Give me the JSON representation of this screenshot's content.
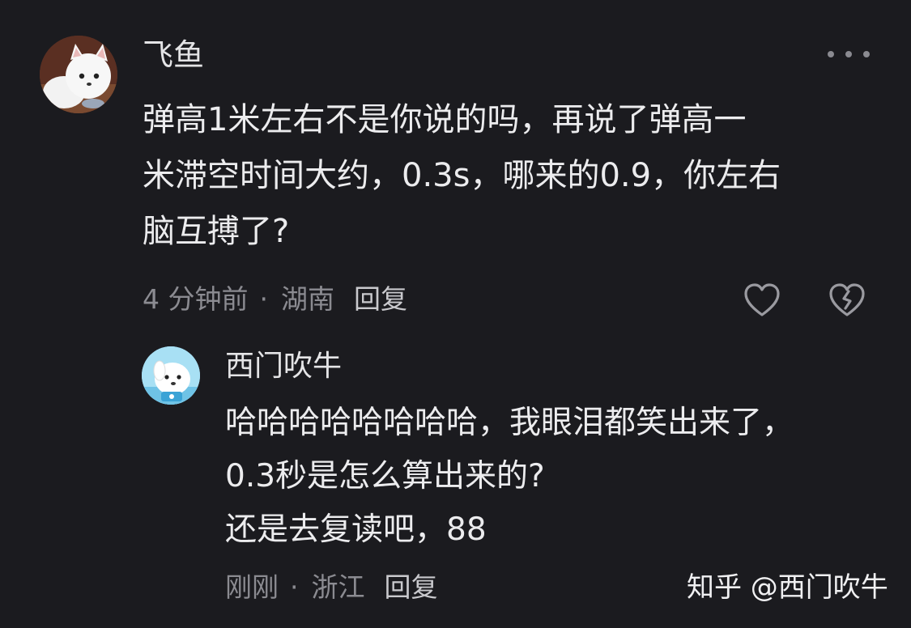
{
  "comment": {
    "author": "飞鱼",
    "text_lines": [
      "弹高1米左右不是你说的吗，再说了弹高一",
      "米滞空时间大约，0.3s，哪来的0.9，你左右",
      "脑互搏了?"
    ],
    "time": "4 分钟前",
    "separator": "·",
    "location": "湖南",
    "reply_label": "回复",
    "more_icon": "more-horizontal-icon",
    "like_icon": "heart-outline-icon",
    "dislike_icon": "broken-heart-icon"
  },
  "reply": {
    "author": "西门吹牛",
    "text_lines": [
      "哈哈哈哈哈哈哈哈，我眼泪都笑出来了，",
      "0.3秒是怎么算出来的?",
      "还是去复读吧，88"
    ],
    "time": "刚刚",
    "separator": "·",
    "location": "浙江",
    "reply_label": "回复"
  },
  "watermark": "知乎 @西门吹牛",
  "colors": {
    "background": "#1b1b1f",
    "text_primary": "#ececee",
    "text_secondary": "#8b8b91",
    "icon": "#8a8a90"
  }
}
